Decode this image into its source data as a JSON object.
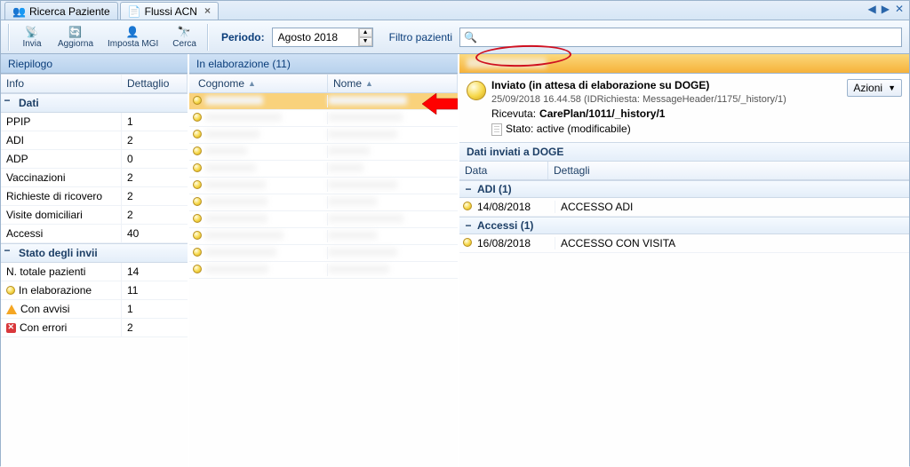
{
  "tabs": {
    "ricerca": "Ricerca Paziente",
    "flussi": "Flussi ACN"
  },
  "toolbar": {
    "invia": "Invia",
    "aggiorna": "Aggiorna",
    "imposta_mgi": "Imposta MGI",
    "cerca": "Cerca",
    "periodo_label": "Periodo:",
    "periodo_value": "Agosto 2018",
    "filtro_label": "Filtro pazienti"
  },
  "riepilogo": {
    "title": "Riepilogo",
    "cols": {
      "info": "Info",
      "dett": "Dettaglio"
    },
    "dati": {
      "label": "Dati",
      "rows": [
        {
          "k": "PPIP",
          "v": "1"
        },
        {
          "k": "ADI",
          "v": "2"
        },
        {
          "k": "ADP",
          "v": "0"
        },
        {
          "k": "Vaccinazioni",
          "v": "2"
        },
        {
          "k": "Richieste di ricovero",
          "v": "2"
        },
        {
          "k": "Visite domiciliari",
          "v": "2"
        },
        {
          "k": "Accessi",
          "v": "40"
        }
      ]
    },
    "stato": {
      "label": "Stato degli invii",
      "rows": [
        {
          "icon": "",
          "k": "N. totale pazienti",
          "v": "14"
        },
        {
          "icon": "circle",
          "k": "In elaborazione",
          "v": "11"
        },
        {
          "icon": "warn",
          "k": "Con avvisi",
          "v": "1"
        },
        {
          "icon": "err",
          "k": "Con errori",
          "v": "2"
        }
      ]
    }
  },
  "elab": {
    "title": "In elaborazione (11)",
    "cols": {
      "cognome": "Cognome",
      "nome": "Nome"
    },
    "row_count": 11
  },
  "detail": {
    "status_title": "Inviato (in attesa di elaborazione su DOGE)",
    "status_sub": "25/09/2018 16.44.58   (IDRichiesta: MessageHeader/1175/_history/1)",
    "ricevuta_label": "Ricevuta:",
    "ricevuta_value": "CarePlan/1011/_history/1",
    "stato_label": "Stato: active (modificabile)",
    "azioni": "Azioni",
    "doge_title": "Dati inviati a DOGE",
    "doge_cols": {
      "data": "Data",
      "dett": "Dettagli"
    },
    "groups": [
      {
        "label": "ADI (1)",
        "rows": [
          {
            "data": "14/08/2018",
            "dett": "ACCESSO ADI"
          }
        ]
      },
      {
        "label": "Accessi (1)",
        "rows": [
          {
            "data": "16/08/2018",
            "dett": "ACCESSO CON VISITA"
          }
        ]
      }
    ]
  }
}
